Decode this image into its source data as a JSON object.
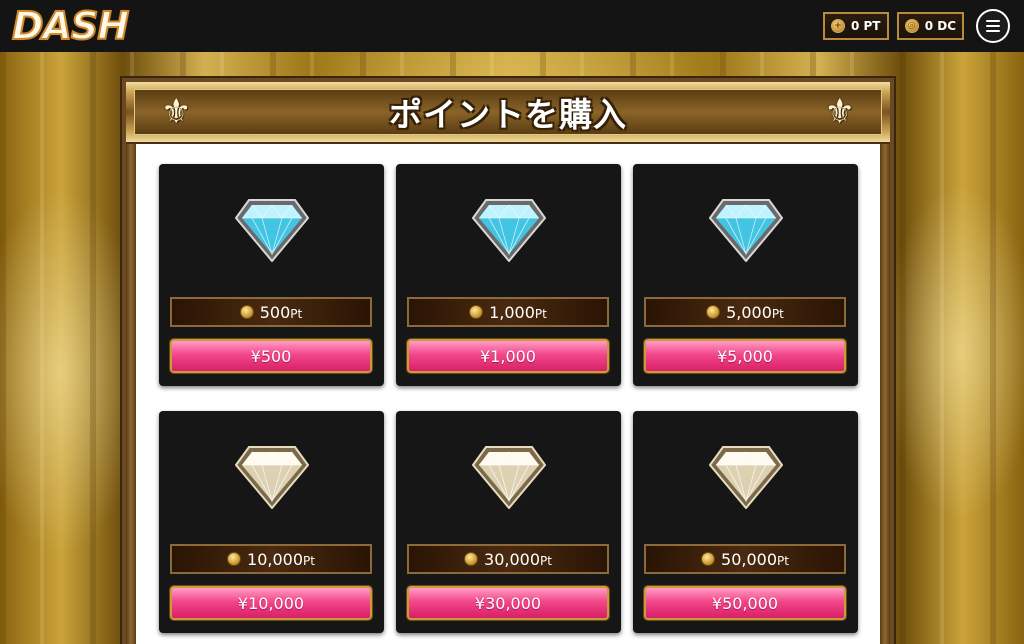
{
  "header": {
    "logo": "DASH",
    "pt_balance": "0 PT",
    "dc_balance": "0 DC",
    "pt_icon": "pt-coin-icon",
    "dc_icon": "dc-coin-icon",
    "menu_icon": "hamburger-menu-icon"
  },
  "panel": {
    "title": "ポイントを購入",
    "ornament_icon": "fleur-de-lis-icon",
    "ornament_glyph": "⚜"
  },
  "cards": [
    {
      "gem": "blue",
      "points": "500",
      "unit": "Pt",
      "price": "¥500"
    },
    {
      "gem": "blue",
      "points": "1,000",
      "unit": "Pt",
      "price": "¥1,000"
    },
    {
      "gem": "blue",
      "points": "5,000",
      "unit": "Pt",
      "price": "¥5,000"
    },
    {
      "gem": "white",
      "points": "10,000",
      "unit": "Pt",
      "price": "¥10,000"
    },
    {
      "gem": "white",
      "points": "30,000",
      "unit": "Pt",
      "price": "¥30,000"
    },
    {
      "gem": "white",
      "points": "50,000",
      "unit": "Pt",
      "price": "¥50,000"
    }
  ],
  "colors": {
    "price_button": "#f2478a",
    "blue_gem": "#5fd9f2",
    "white_gem": "#efe6cf",
    "gold_border": "#c99a3e"
  }
}
